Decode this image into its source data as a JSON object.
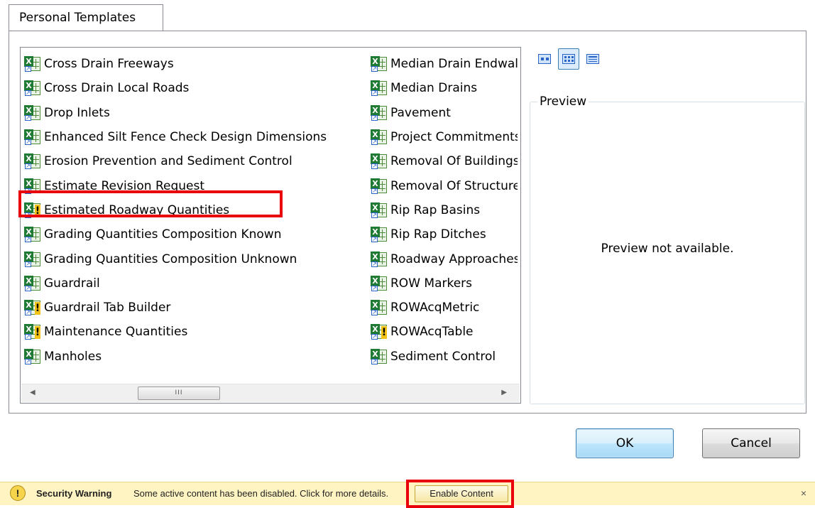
{
  "tabs": [
    {
      "label": "Personal Templates"
    }
  ],
  "list": {
    "column1": [
      {
        "label": "Cross Drain Freeways",
        "warning": false
      },
      {
        "label": "Cross Drain Local Roads",
        "warning": false
      },
      {
        "label": "Drop Inlets",
        "warning": false
      },
      {
        "label": "Enhanced Silt Fence Check Design Dimensions",
        "warning": false
      },
      {
        "label": "Erosion Prevention and Sediment Control",
        "warning": false
      },
      {
        "label": "Estimate Revision Request",
        "warning": false
      },
      {
        "label": "Estimated Roadway Quantities",
        "warning": true,
        "highlighted": true
      },
      {
        "label": "Grading Quantities Composition Known",
        "warning": false
      },
      {
        "label": "Grading Quantities Composition Unknown",
        "warning": false
      },
      {
        "label": "Guardrail",
        "warning": false
      },
      {
        "label": "Guardrail Tab Builder",
        "warning": true
      },
      {
        "label": "Maintenance Quantities",
        "warning": true
      },
      {
        "label": "Manholes",
        "warning": false
      }
    ],
    "column2": [
      {
        "label": "Median Drain Endwalls",
        "warning": false
      },
      {
        "label": "Median Drains",
        "warning": false
      },
      {
        "label": "Pavement",
        "warning": false
      },
      {
        "label": "Project Commitments",
        "warning": false
      },
      {
        "label": "Removal Of Buildings",
        "warning": false
      },
      {
        "label": "Removal Of Structures",
        "warning": false
      },
      {
        "label": "Rip Rap Basins",
        "warning": false
      },
      {
        "label": "Rip Rap Ditches",
        "warning": false
      },
      {
        "label": "Roadway Approaches",
        "warning": false
      },
      {
        "label": "ROW Markers",
        "warning": false
      },
      {
        "label": "ROWAcqMetric",
        "warning": false
      },
      {
        "label": "ROWAcqTable",
        "warning": true
      },
      {
        "label": "Sediment Control",
        "warning": false
      }
    ],
    "scroll_thumb_grip": "III"
  },
  "view_buttons": [
    {
      "icon": "large-icons-view-icon",
      "active": false
    },
    {
      "icon": "list-view-icon",
      "active": true
    },
    {
      "icon": "details-view-icon",
      "active": false
    }
  ],
  "preview": {
    "title": "Preview",
    "message": "Preview not available."
  },
  "buttons": {
    "ok": "OK",
    "cancel": "Cancel"
  },
  "security_bar": {
    "icon": "warning-icon",
    "title": "Security Warning",
    "message": "Some active content has been disabled. Click for more details.",
    "enable_label": "Enable Content",
    "close_glyph": "×"
  },
  "colors": {
    "highlight": "#e8000b",
    "security_bar_bg": "#fff4c2",
    "excel_green": "#1f7a34"
  }
}
